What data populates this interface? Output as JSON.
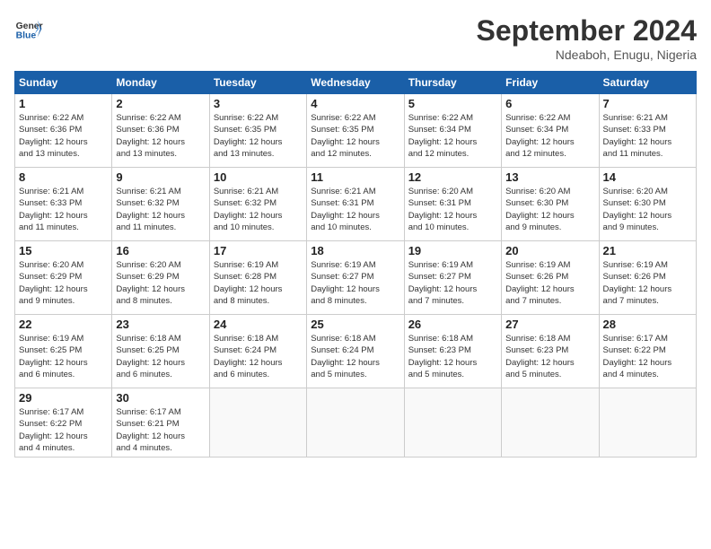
{
  "header": {
    "logo_general": "General",
    "logo_blue": "Blue",
    "month": "September 2024",
    "location": "Ndeaboh, Enugu, Nigeria"
  },
  "weekdays": [
    "Sunday",
    "Monday",
    "Tuesday",
    "Wednesday",
    "Thursday",
    "Friday",
    "Saturday"
  ],
  "weeks": [
    [
      {
        "day": "1",
        "info": "Sunrise: 6:22 AM\nSunset: 6:36 PM\nDaylight: 12 hours\nand 13 minutes."
      },
      {
        "day": "2",
        "info": "Sunrise: 6:22 AM\nSunset: 6:36 PM\nDaylight: 12 hours\nand 13 minutes."
      },
      {
        "day": "3",
        "info": "Sunrise: 6:22 AM\nSunset: 6:35 PM\nDaylight: 12 hours\nand 13 minutes."
      },
      {
        "day": "4",
        "info": "Sunrise: 6:22 AM\nSunset: 6:35 PM\nDaylight: 12 hours\nand 12 minutes."
      },
      {
        "day": "5",
        "info": "Sunrise: 6:22 AM\nSunset: 6:34 PM\nDaylight: 12 hours\nand 12 minutes."
      },
      {
        "day": "6",
        "info": "Sunrise: 6:22 AM\nSunset: 6:34 PM\nDaylight: 12 hours\nand 12 minutes."
      },
      {
        "day": "7",
        "info": "Sunrise: 6:21 AM\nSunset: 6:33 PM\nDaylight: 12 hours\nand 11 minutes."
      }
    ],
    [
      {
        "day": "8",
        "info": "Sunrise: 6:21 AM\nSunset: 6:33 PM\nDaylight: 12 hours\nand 11 minutes."
      },
      {
        "day": "9",
        "info": "Sunrise: 6:21 AM\nSunset: 6:32 PM\nDaylight: 12 hours\nand 11 minutes."
      },
      {
        "day": "10",
        "info": "Sunrise: 6:21 AM\nSunset: 6:32 PM\nDaylight: 12 hours\nand 10 minutes."
      },
      {
        "day": "11",
        "info": "Sunrise: 6:21 AM\nSunset: 6:31 PM\nDaylight: 12 hours\nand 10 minutes."
      },
      {
        "day": "12",
        "info": "Sunrise: 6:20 AM\nSunset: 6:31 PM\nDaylight: 12 hours\nand 10 minutes."
      },
      {
        "day": "13",
        "info": "Sunrise: 6:20 AM\nSunset: 6:30 PM\nDaylight: 12 hours\nand 9 minutes."
      },
      {
        "day": "14",
        "info": "Sunrise: 6:20 AM\nSunset: 6:30 PM\nDaylight: 12 hours\nand 9 minutes."
      }
    ],
    [
      {
        "day": "15",
        "info": "Sunrise: 6:20 AM\nSunset: 6:29 PM\nDaylight: 12 hours\nand 9 minutes."
      },
      {
        "day": "16",
        "info": "Sunrise: 6:20 AM\nSunset: 6:29 PM\nDaylight: 12 hours\nand 8 minutes."
      },
      {
        "day": "17",
        "info": "Sunrise: 6:19 AM\nSunset: 6:28 PM\nDaylight: 12 hours\nand 8 minutes."
      },
      {
        "day": "18",
        "info": "Sunrise: 6:19 AM\nSunset: 6:27 PM\nDaylight: 12 hours\nand 8 minutes."
      },
      {
        "day": "19",
        "info": "Sunrise: 6:19 AM\nSunset: 6:27 PM\nDaylight: 12 hours\nand 7 minutes."
      },
      {
        "day": "20",
        "info": "Sunrise: 6:19 AM\nSunset: 6:26 PM\nDaylight: 12 hours\nand 7 minutes."
      },
      {
        "day": "21",
        "info": "Sunrise: 6:19 AM\nSunset: 6:26 PM\nDaylight: 12 hours\nand 7 minutes."
      }
    ],
    [
      {
        "day": "22",
        "info": "Sunrise: 6:19 AM\nSunset: 6:25 PM\nDaylight: 12 hours\nand 6 minutes."
      },
      {
        "day": "23",
        "info": "Sunrise: 6:18 AM\nSunset: 6:25 PM\nDaylight: 12 hours\nand 6 minutes."
      },
      {
        "day": "24",
        "info": "Sunrise: 6:18 AM\nSunset: 6:24 PM\nDaylight: 12 hours\nand 6 minutes."
      },
      {
        "day": "25",
        "info": "Sunrise: 6:18 AM\nSunset: 6:24 PM\nDaylight: 12 hours\nand 5 minutes."
      },
      {
        "day": "26",
        "info": "Sunrise: 6:18 AM\nSunset: 6:23 PM\nDaylight: 12 hours\nand 5 minutes."
      },
      {
        "day": "27",
        "info": "Sunrise: 6:18 AM\nSunset: 6:23 PM\nDaylight: 12 hours\nand 5 minutes."
      },
      {
        "day": "28",
        "info": "Sunrise: 6:17 AM\nSunset: 6:22 PM\nDaylight: 12 hours\nand 4 minutes."
      }
    ],
    [
      {
        "day": "29",
        "info": "Sunrise: 6:17 AM\nSunset: 6:22 PM\nDaylight: 12 hours\nand 4 minutes."
      },
      {
        "day": "30",
        "info": "Sunrise: 6:17 AM\nSunset: 6:21 PM\nDaylight: 12 hours\nand 4 minutes."
      },
      {
        "day": "",
        "info": ""
      },
      {
        "day": "",
        "info": ""
      },
      {
        "day": "",
        "info": ""
      },
      {
        "day": "",
        "info": ""
      },
      {
        "day": "",
        "info": ""
      }
    ]
  ]
}
